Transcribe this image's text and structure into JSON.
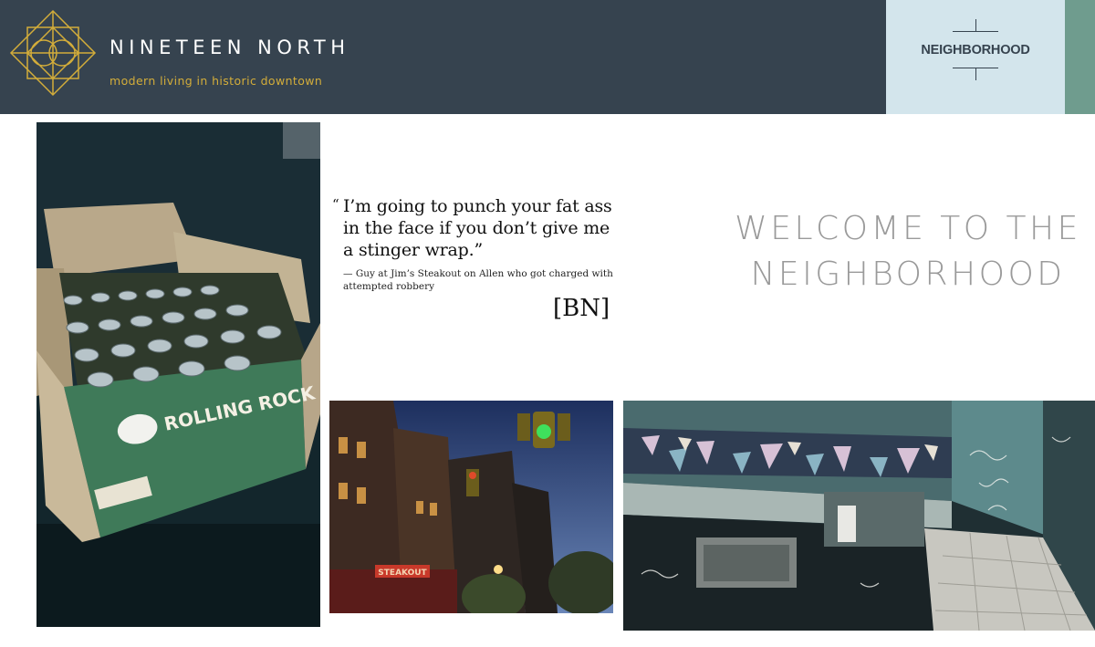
{
  "header": {
    "brand_name": "NINETEEN NORTH",
    "tagline": "modern living in historic downtown",
    "logo_icon": "geometric-diamond-logo",
    "nav_label": "NEIGHBORHOOD",
    "colors": {
      "header_bg": "#36434f",
      "brand_gold": "#d3ad3a",
      "nav_bg": "#d3e5ec",
      "accent_green": "#6f9c8e"
    }
  },
  "quote": {
    "open_mark": "“",
    "text": "I’m going to punch your fat ass in the face if you don’t give me a stinger wrap.”",
    "attribution": "— Guy at Jim’s Steakout on Allen who got charged with attempted robbery",
    "publication_logo": "[BN]"
  },
  "welcome": {
    "line1": "WELCOME TO THE",
    "line2": "NEIGHBORHOOD"
  },
  "photos": {
    "box_label": "ROLLING ROCK",
    "street_sign": "STEAKOUT"
  }
}
